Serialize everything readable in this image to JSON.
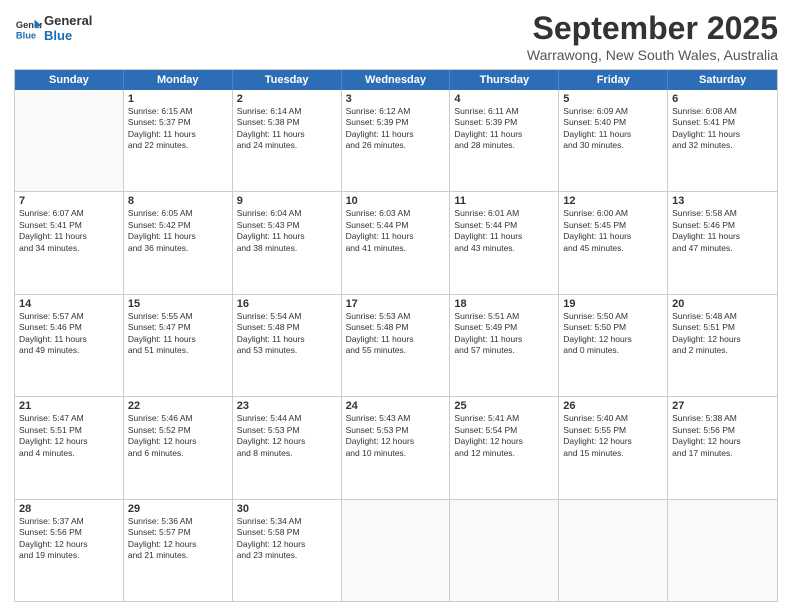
{
  "header": {
    "logo_line1": "General",
    "logo_line2": "Blue",
    "month": "September 2025",
    "location": "Warrawong, New South Wales, Australia"
  },
  "days_of_week": [
    "Sunday",
    "Monday",
    "Tuesday",
    "Wednesday",
    "Thursday",
    "Friday",
    "Saturday"
  ],
  "weeks": [
    [
      {
        "day": "",
        "info": ""
      },
      {
        "day": "1",
        "info": "Sunrise: 6:15 AM\nSunset: 5:37 PM\nDaylight: 11 hours\nand 22 minutes."
      },
      {
        "day": "2",
        "info": "Sunrise: 6:14 AM\nSunset: 5:38 PM\nDaylight: 11 hours\nand 24 minutes."
      },
      {
        "day": "3",
        "info": "Sunrise: 6:12 AM\nSunset: 5:39 PM\nDaylight: 11 hours\nand 26 minutes."
      },
      {
        "day": "4",
        "info": "Sunrise: 6:11 AM\nSunset: 5:39 PM\nDaylight: 11 hours\nand 28 minutes."
      },
      {
        "day": "5",
        "info": "Sunrise: 6:09 AM\nSunset: 5:40 PM\nDaylight: 11 hours\nand 30 minutes."
      },
      {
        "day": "6",
        "info": "Sunrise: 6:08 AM\nSunset: 5:41 PM\nDaylight: 11 hours\nand 32 minutes."
      }
    ],
    [
      {
        "day": "7",
        "info": "Sunrise: 6:07 AM\nSunset: 5:41 PM\nDaylight: 11 hours\nand 34 minutes."
      },
      {
        "day": "8",
        "info": "Sunrise: 6:05 AM\nSunset: 5:42 PM\nDaylight: 11 hours\nand 36 minutes."
      },
      {
        "day": "9",
        "info": "Sunrise: 6:04 AM\nSunset: 5:43 PM\nDaylight: 11 hours\nand 38 minutes."
      },
      {
        "day": "10",
        "info": "Sunrise: 6:03 AM\nSunset: 5:44 PM\nDaylight: 11 hours\nand 41 minutes."
      },
      {
        "day": "11",
        "info": "Sunrise: 6:01 AM\nSunset: 5:44 PM\nDaylight: 11 hours\nand 43 minutes."
      },
      {
        "day": "12",
        "info": "Sunrise: 6:00 AM\nSunset: 5:45 PM\nDaylight: 11 hours\nand 45 minutes."
      },
      {
        "day": "13",
        "info": "Sunrise: 5:58 AM\nSunset: 5:46 PM\nDaylight: 11 hours\nand 47 minutes."
      }
    ],
    [
      {
        "day": "14",
        "info": "Sunrise: 5:57 AM\nSunset: 5:46 PM\nDaylight: 11 hours\nand 49 minutes."
      },
      {
        "day": "15",
        "info": "Sunrise: 5:55 AM\nSunset: 5:47 PM\nDaylight: 11 hours\nand 51 minutes."
      },
      {
        "day": "16",
        "info": "Sunrise: 5:54 AM\nSunset: 5:48 PM\nDaylight: 11 hours\nand 53 minutes."
      },
      {
        "day": "17",
        "info": "Sunrise: 5:53 AM\nSunset: 5:48 PM\nDaylight: 11 hours\nand 55 minutes."
      },
      {
        "day": "18",
        "info": "Sunrise: 5:51 AM\nSunset: 5:49 PM\nDaylight: 11 hours\nand 57 minutes."
      },
      {
        "day": "19",
        "info": "Sunrise: 5:50 AM\nSunset: 5:50 PM\nDaylight: 12 hours\nand 0 minutes."
      },
      {
        "day": "20",
        "info": "Sunrise: 5:48 AM\nSunset: 5:51 PM\nDaylight: 12 hours\nand 2 minutes."
      }
    ],
    [
      {
        "day": "21",
        "info": "Sunrise: 5:47 AM\nSunset: 5:51 PM\nDaylight: 12 hours\nand 4 minutes."
      },
      {
        "day": "22",
        "info": "Sunrise: 5:46 AM\nSunset: 5:52 PM\nDaylight: 12 hours\nand 6 minutes."
      },
      {
        "day": "23",
        "info": "Sunrise: 5:44 AM\nSunset: 5:53 PM\nDaylight: 12 hours\nand 8 minutes."
      },
      {
        "day": "24",
        "info": "Sunrise: 5:43 AM\nSunset: 5:53 PM\nDaylight: 12 hours\nand 10 minutes."
      },
      {
        "day": "25",
        "info": "Sunrise: 5:41 AM\nSunset: 5:54 PM\nDaylight: 12 hours\nand 12 minutes."
      },
      {
        "day": "26",
        "info": "Sunrise: 5:40 AM\nSunset: 5:55 PM\nDaylight: 12 hours\nand 15 minutes."
      },
      {
        "day": "27",
        "info": "Sunrise: 5:38 AM\nSunset: 5:56 PM\nDaylight: 12 hours\nand 17 minutes."
      }
    ],
    [
      {
        "day": "28",
        "info": "Sunrise: 5:37 AM\nSunset: 5:56 PM\nDaylight: 12 hours\nand 19 minutes."
      },
      {
        "day": "29",
        "info": "Sunrise: 5:36 AM\nSunset: 5:57 PM\nDaylight: 12 hours\nand 21 minutes."
      },
      {
        "day": "30",
        "info": "Sunrise: 5:34 AM\nSunset: 5:58 PM\nDaylight: 12 hours\nand 23 minutes."
      },
      {
        "day": "",
        "info": ""
      },
      {
        "day": "",
        "info": ""
      },
      {
        "day": "",
        "info": ""
      },
      {
        "day": "",
        "info": ""
      }
    ]
  ]
}
